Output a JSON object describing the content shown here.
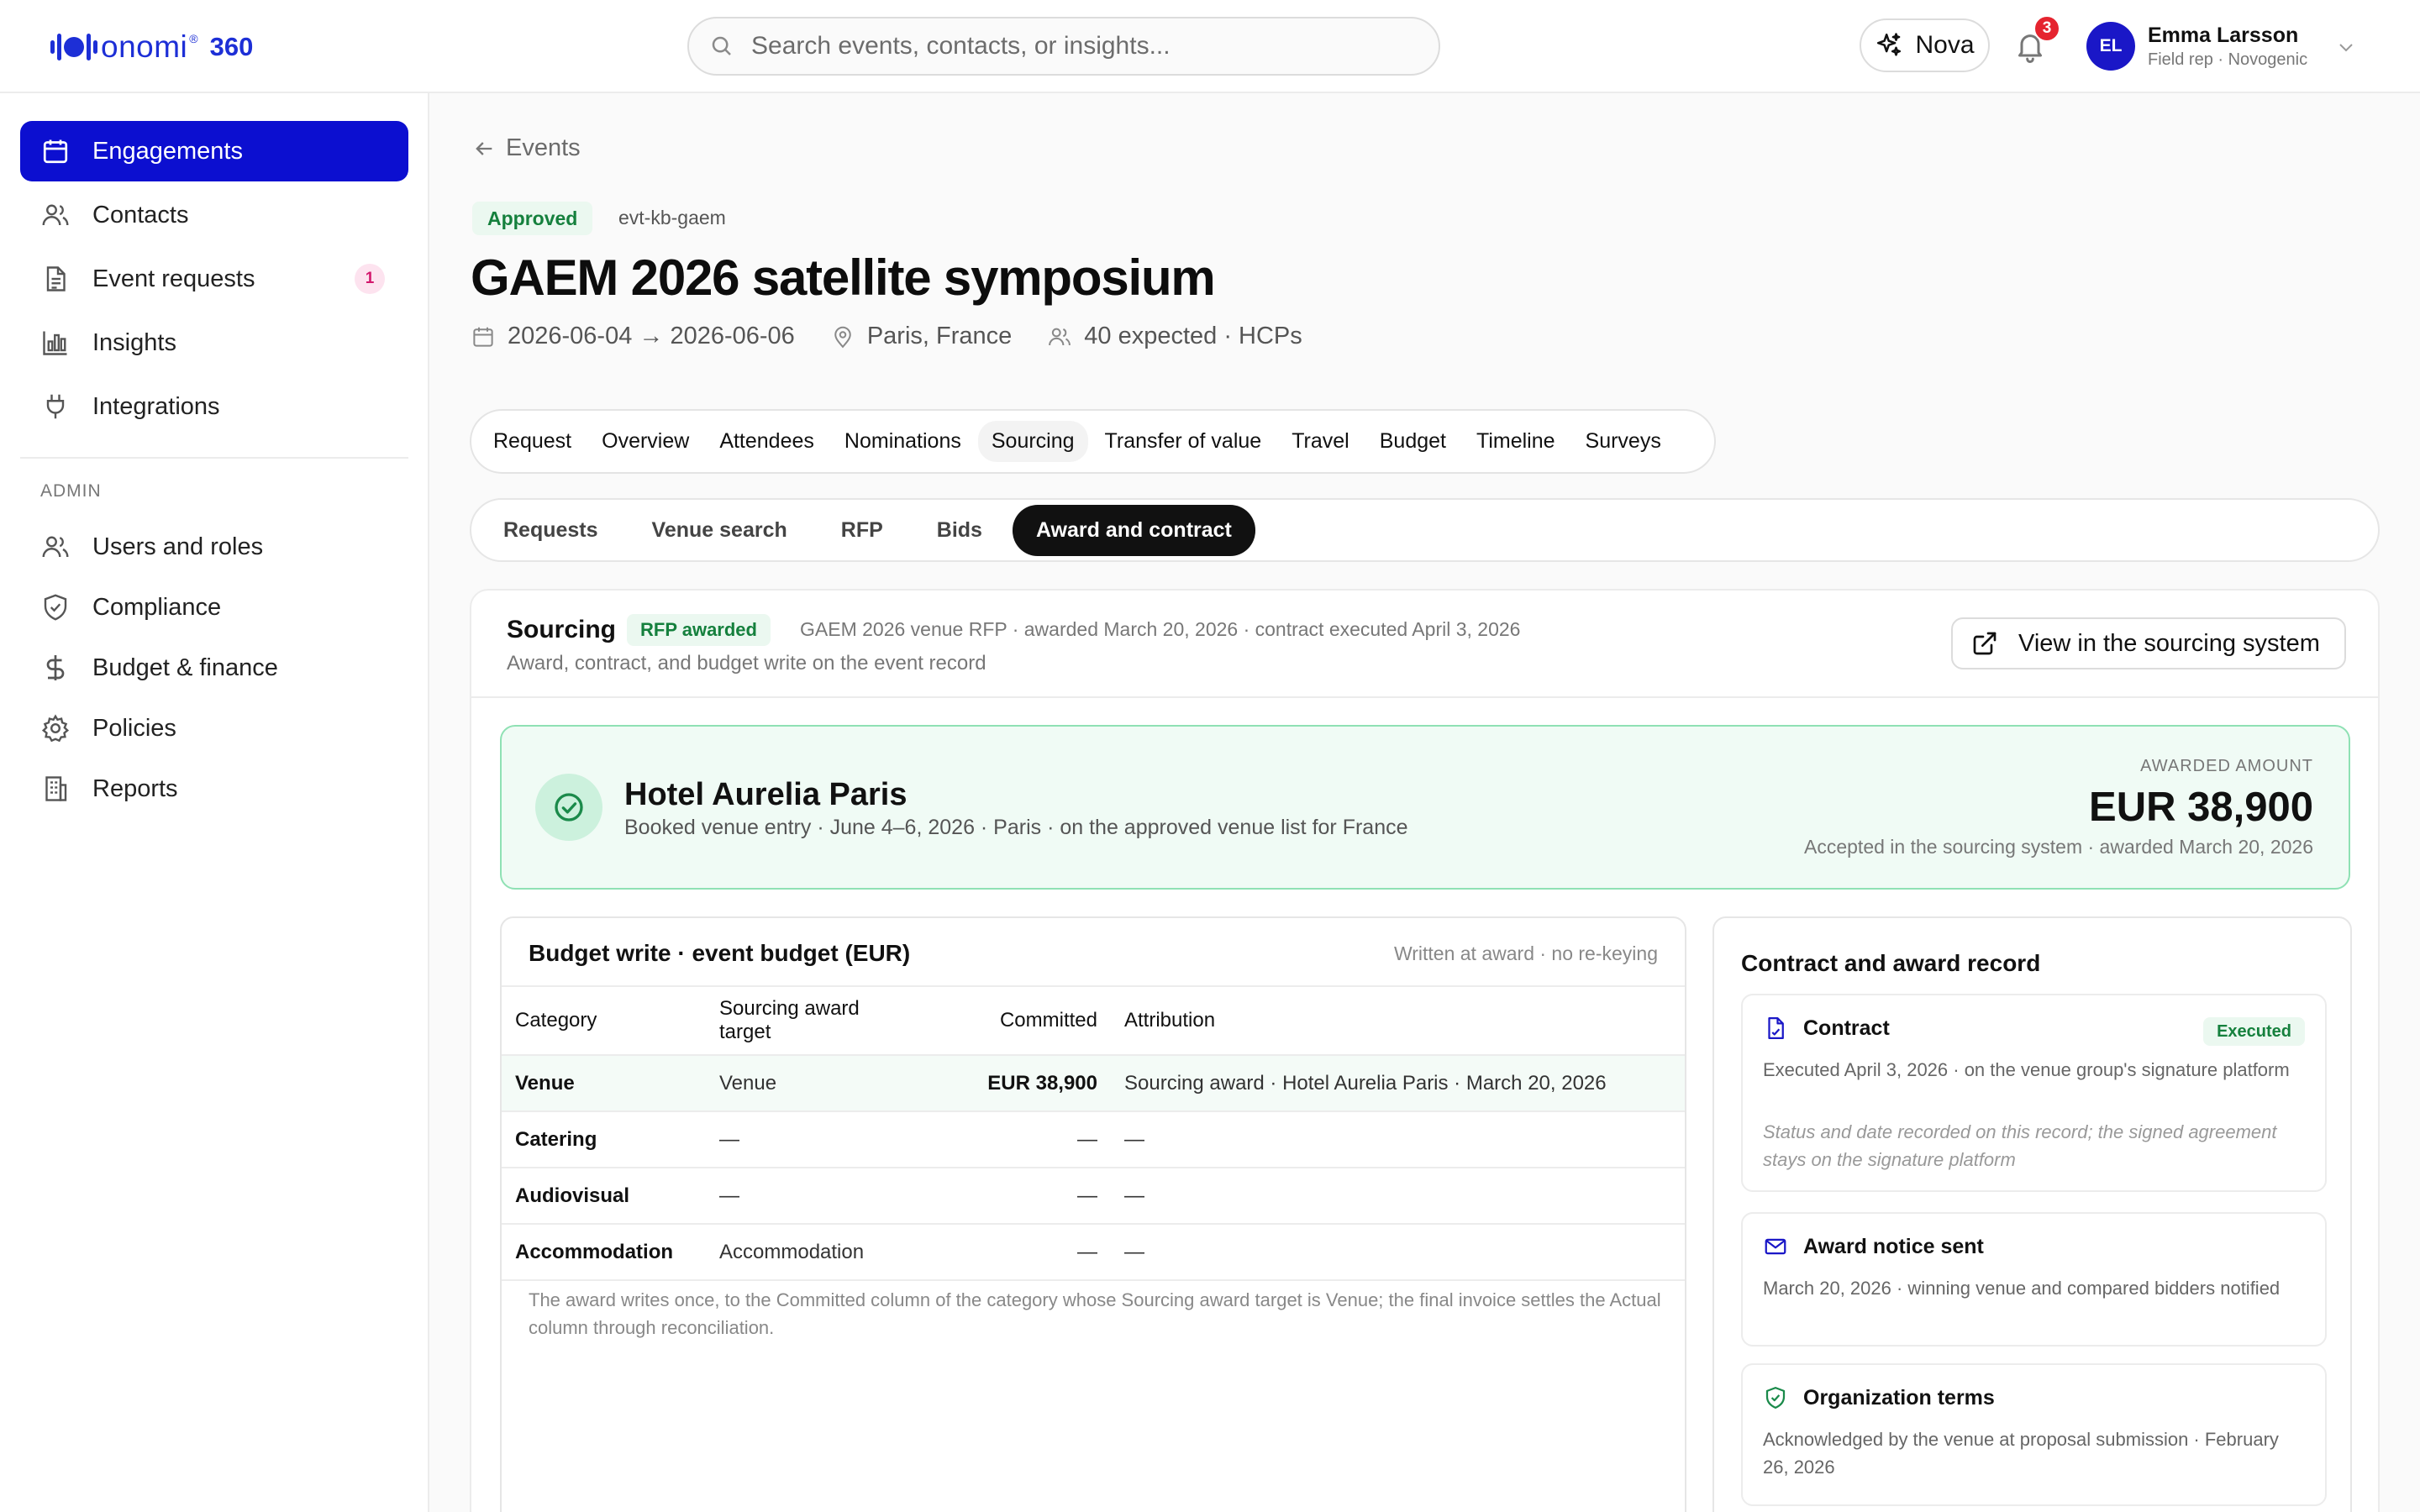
{
  "app": {
    "logo_text": "onomi",
    "logo_reg": "®",
    "logo_suffix": "360"
  },
  "search": {
    "placeholder": "Search events, contacts, or insights..."
  },
  "header": {
    "nova_label": "Nova",
    "notification_count": "3",
    "user": {
      "initials": "EL",
      "name": "Emma Larsson",
      "role": "Field rep · Novogenic"
    }
  },
  "sidebar": {
    "items": [
      {
        "label": "Engagements",
        "icon": "calendar-icon",
        "active": true
      },
      {
        "label": "Contacts",
        "icon": "users-icon"
      },
      {
        "label": "Event requests",
        "icon": "document-icon",
        "badge": "1"
      },
      {
        "label": "Insights",
        "icon": "bar-chart-icon"
      },
      {
        "label": "Integrations",
        "icon": "plug-icon"
      }
    ],
    "admin_label": "ADMIN",
    "admin_items": [
      {
        "label": "Users and roles",
        "icon": "users-icon"
      },
      {
        "label": "Compliance",
        "icon": "shield-icon"
      },
      {
        "label": "Budget & finance",
        "icon": "dollar-icon"
      },
      {
        "label": "Policies",
        "icon": "gear-icon"
      },
      {
        "label": "Reports",
        "icon": "building-icon"
      }
    ]
  },
  "breadcrumb": {
    "back_label": "Events"
  },
  "event": {
    "status": "Approved",
    "code": "evt-kb-gaem",
    "title": "GAEM 2026 satellite symposium",
    "dates": "2026-06-04 → 2026-06-06",
    "location": "Paris, France",
    "attendance": "40 expected · HCPs"
  },
  "tabs": {
    "main": [
      "Request",
      "Overview",
      "Attendees",
      "Nominations",
      "Sourcing",
      "Transfer of value",
      "Travel",
      "Budget",
      "Timeline",
      "Surveys"
    ],
    "main_active": "Sourcing",
    "sub": [
      "Requests",
      "Venue search",
      "RFP",
      "Bids",
      "Award and contract"
    ],
    "sub_active": "Award and contract"
  },
  "sourcing": {
    "title": "Sourcing",
    "status": "RFP awarded",
    "meta": "GAEM 2026 venue RFP · awarded March 20, 2026 · contract executed April 3, 2026",
    "subtitle": "Award, contract, and budget write on the event record",
    "view_button": "View in the sourcing system"
  },
  "award": {
    "venue": "Hotel Aurelia Paris",
    "description": "Booked venue entry · June 4–6, 2026 · Paris · on the approved venue list for France",
    "amount_label": "AWARDED AMOUNT",
    "amount": "EUR 38,900",
    "amount_meta": "Accepted in the sourcing system · awarded March 20, 2026"
  },
  "budget": {
    "title": "Budget write · event budget (EUR)",
    "note": "Written at award · no re-keying",
    "columns": [
      "Category",
      "Sourcing award target",
      "Committed",
      "Attribution"
    ],
    "rows": [
      {
        "category": "Venue",
        "target": "Venue",
        "committed": "EUR 38,900",
        "attribution": "Sourcing award · Hotel Aurelia Paris · March 20, 2026"
      },
      {
        "category": "Catering",
        "target": "—",
        "committed": "—",
        "attribution": "—"
      },
      {
        "category": "Audiovisual",
        "target": "—",
        "committed": "—",
        "attribution": "—"
      },
      {
        "category": "Accommodation",
        "target": "Accommodation",
        "committed": "—",
        "attribution": "—"
      }
    ],
    "footnote": "The award writes once, to the Committed column of the category whose Sourcing award target is Venue; the final invoice settles the Actual column through reconciliation."
  },
  "contract": {
    "title": "Contract and award record",
    "records": [
      {
        "title": "Contract",
        "icon": "file-signature-icon",
        "status": "Executed",
        "body": "Executed April 3, 2026 · on the venue group's signature platform",
        "note": "Status and date recorded on this record; the signed agreement stays on the signature platform"
      },
      {
        "title": "Award notice sent",
        "icon": "mail-icon",
        "body": "March 20, 2026 · winning venue and compared bidders notified"
      },
      {
        "title": "Organization terms",
        "icon": "shield-check-icon",
        "body": "Acknowledged by the venue at proposal submission · February 26, 2026"
      }
    ]
  },
  "colors": {
    "brand": "#1d2fd6",
    "nav_active": "#0c0fd0",
    "success": "#15803d",
    "success_bg": "#ebf8f0",
    "alert": "#e5242f"
  }
}
